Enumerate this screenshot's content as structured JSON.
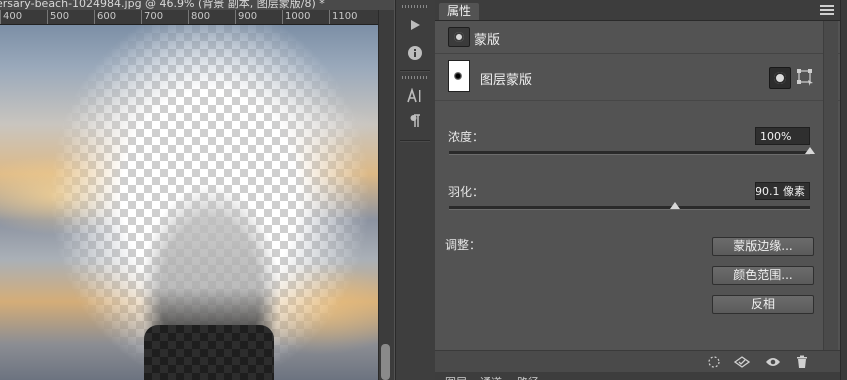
{
  "document": {
    "tab_title": "ersary-beach-1024984.jpg @ 46.9% (背景 副本, 图层蒙版/8) *",
    "close_glyph": "×",
    "ruler_labels": [
      "400",
      "500",
      "600",
      "700",
      "800",
      "900",
      "1000",
      "1100"
    ]
  },
  "panel": {
    "tab_label": "属性",
    "title": "蒙版",
    "mask_type_label": "图层蒙版",
    "density_label": "浓度：",
    "density_value": "100%",
    "feather_label": "羽化：",
    "feather_value": "90.1 像素",
    "adjust_label": "调整：",
    "buttons": {
      "mask_edge": "蒙版边缘...",
      "color_range": "颜色范围...",
      "invert": "反相"
    }
  },
  "sliders": {
    "density_fraction": 1.0,
    "feather_fraction": 0.625
  },
  "bottom_tabs": [
    "图层",
    "通道",
    "路径"
  ],
  "colors": {
    "panel_bg": "#535353",
    "dark_bg": "#282828",
    "button_bg": "#646464",
    "field_bg": "#2f2f2f"
  }
}
